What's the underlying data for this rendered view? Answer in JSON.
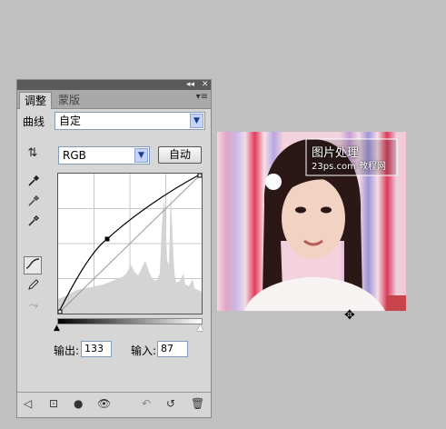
{
  "panel": {
    "collapse_glyph": "◂◂",
    "close_glyph": "✕",
    "tabs": [
      "调整",
      "蒙版"
    ],
    "menu_glyph": "▾≡",
    "curve_label": "曲线",
    "preset_value": "自定",
    "channel_value": "RGB",
    "auto_button": "自动",
    "output_label": "输出:",
    "output_value": "133",
    "input_label": "输入:",
    "input_value": "87"
  },
  "watermark": {
    "line1": "图片处理",
    "line2": "23ps.com 教程网"
  },
  "colors": {
    "panel_bg": "#d6d6d6",
    "titlebar": "#5a5a5a",
    "select_arrow": "#c4d3f6",
    "background": "#c0c0c0"
  }
}
